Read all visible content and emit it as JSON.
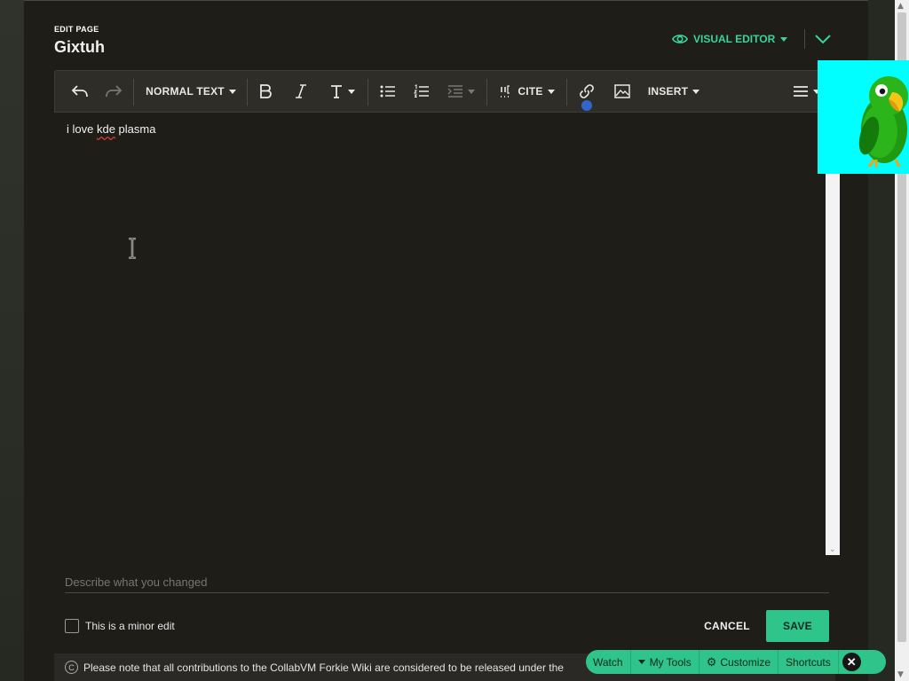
{
  "header": {
    "edit_label": "EDIT PAGE",
    "page_title": "Gixtuh",
    "editor_mode": "VISUAL EDITOR"
  },
  "toolbar": {
    "paragraph_format": "NORMAL TEXT",
    "cite_label": "CITE",
    "insert_label": "INSERT"
  },
  "editor": {
    "content_before": "i love ",
    "content_misspelled": "kde",
    "content_after": " plasma"
  },
  "summary": {
    "placeholder": "Describe what you changed",
    "value": ""
  },
  "options": {
    "minor_edit_label": "This is a minor edit",
    "minor_edit_checked": false
  },
  "actions": {
    "cancel_label": "CANCEL",
    "save_label": "SAVE"
  },
  "notice": {
    "text": "Please note that all contributions to the CollabVM Forkie Wiki are considered to be released under the"
  },
  "toolsbar": {
    "watch": "Watch",
    "my_tools": "My Tools",
    "customize": "Customize",
    "shortcuts": "Shortcuts"
  },
  "colors": {
    "accent": "#2ec48a",
    "mode_accent": "#3ad39b",
    "dialog_bg": "#1e1d18",
    "toolbar_bg": "#2e2d28",
    "parrot_bg": "#00ffff"
  }
}
